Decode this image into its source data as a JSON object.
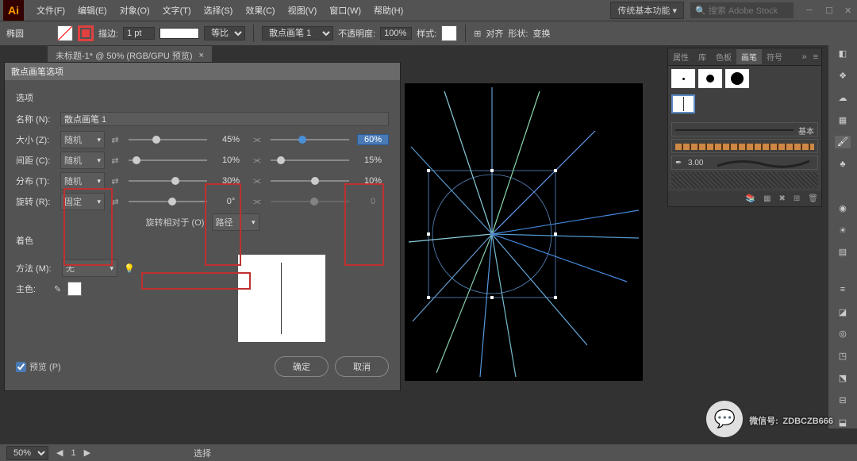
{
  "menubar": {
    "items": [
      "文件(F)",
      "编辑(E)",
      "对象(O)",
      "文字(T)",
      "选择(S)",
      "效果(C)",
      "视图(V)",
      "窗口(W)",
      "帮助(H)"
    ],
    "workspace": "传统基本功能",
    "search_placeholder": "搜索 Adobe Stock"
  },
  "toolbar": {
    "shape": "椭圆",
    "stroke_label": "描边:",
    "stroke_val": "1 pt",
    "uniform": "等比",
    "brush_label": "散点画笔 1",
    "opacity_label": "不透明度:",
    "opacity_val": "100%",
    "style_label": "样式:",
    "align_label": "对齐",
    "shapes_label": "形状:",
    "transform": "变换"
  },
  "doc_tab": {
    "title": "未标题-1* @ 50% (RGB/GPU 预览)",
    "close": "×"
  },
  "dialog": {
    "title": "散点画笔选项",
    "options_label": "选项",
    "name_label": "名称 (N):",
    "name_val": "散点画笔 1",
    "rows": [
      {
        "label": "大小 (Z):",
        "mode": "随机",
        "v1": "45%",
        "v2": "60%",
        "v2_hl": true
      },
      {
        "label": "间距 (C):",
        "mode": "随机",
        "v1": "10%",
        "v2": "15%"
      },
      {
        "label": "分布 (T):",
        "mode": "随机",
        "v1": "30%",
        "v2": "10%"
      },
      {
        "label": "旋转 (R):",
        "mode": "固定",
        "v1": "0°",
        "v2": "0"
      }
    ],
    "rotate_rel_label": "旋转相对于 (O):",
    "rotate_rel_val": "路径",
    "color_label": "着色",
    "method_label": "方法 (M):",
    "method_val": "无",
    "keycolor_label": "主色:",
    "preview_chk": "预览 (P)",
    "ok": "确定",
    "cancel": "取消"
  },
  "panel": {
    "tabs": [
      "属性",
      "库",
      "色板",
      "画笔",
      "符号"
    ],
    "active": 3,
    "basic": "基本",
    "val": "3.00"
  },
  "statusbar": {
    "zoom": "50%",
    "tool": "选择"
  },
  "watermark": {
    "label": "微信号:",
    "id": "ZDBCZB666"
  }
}
